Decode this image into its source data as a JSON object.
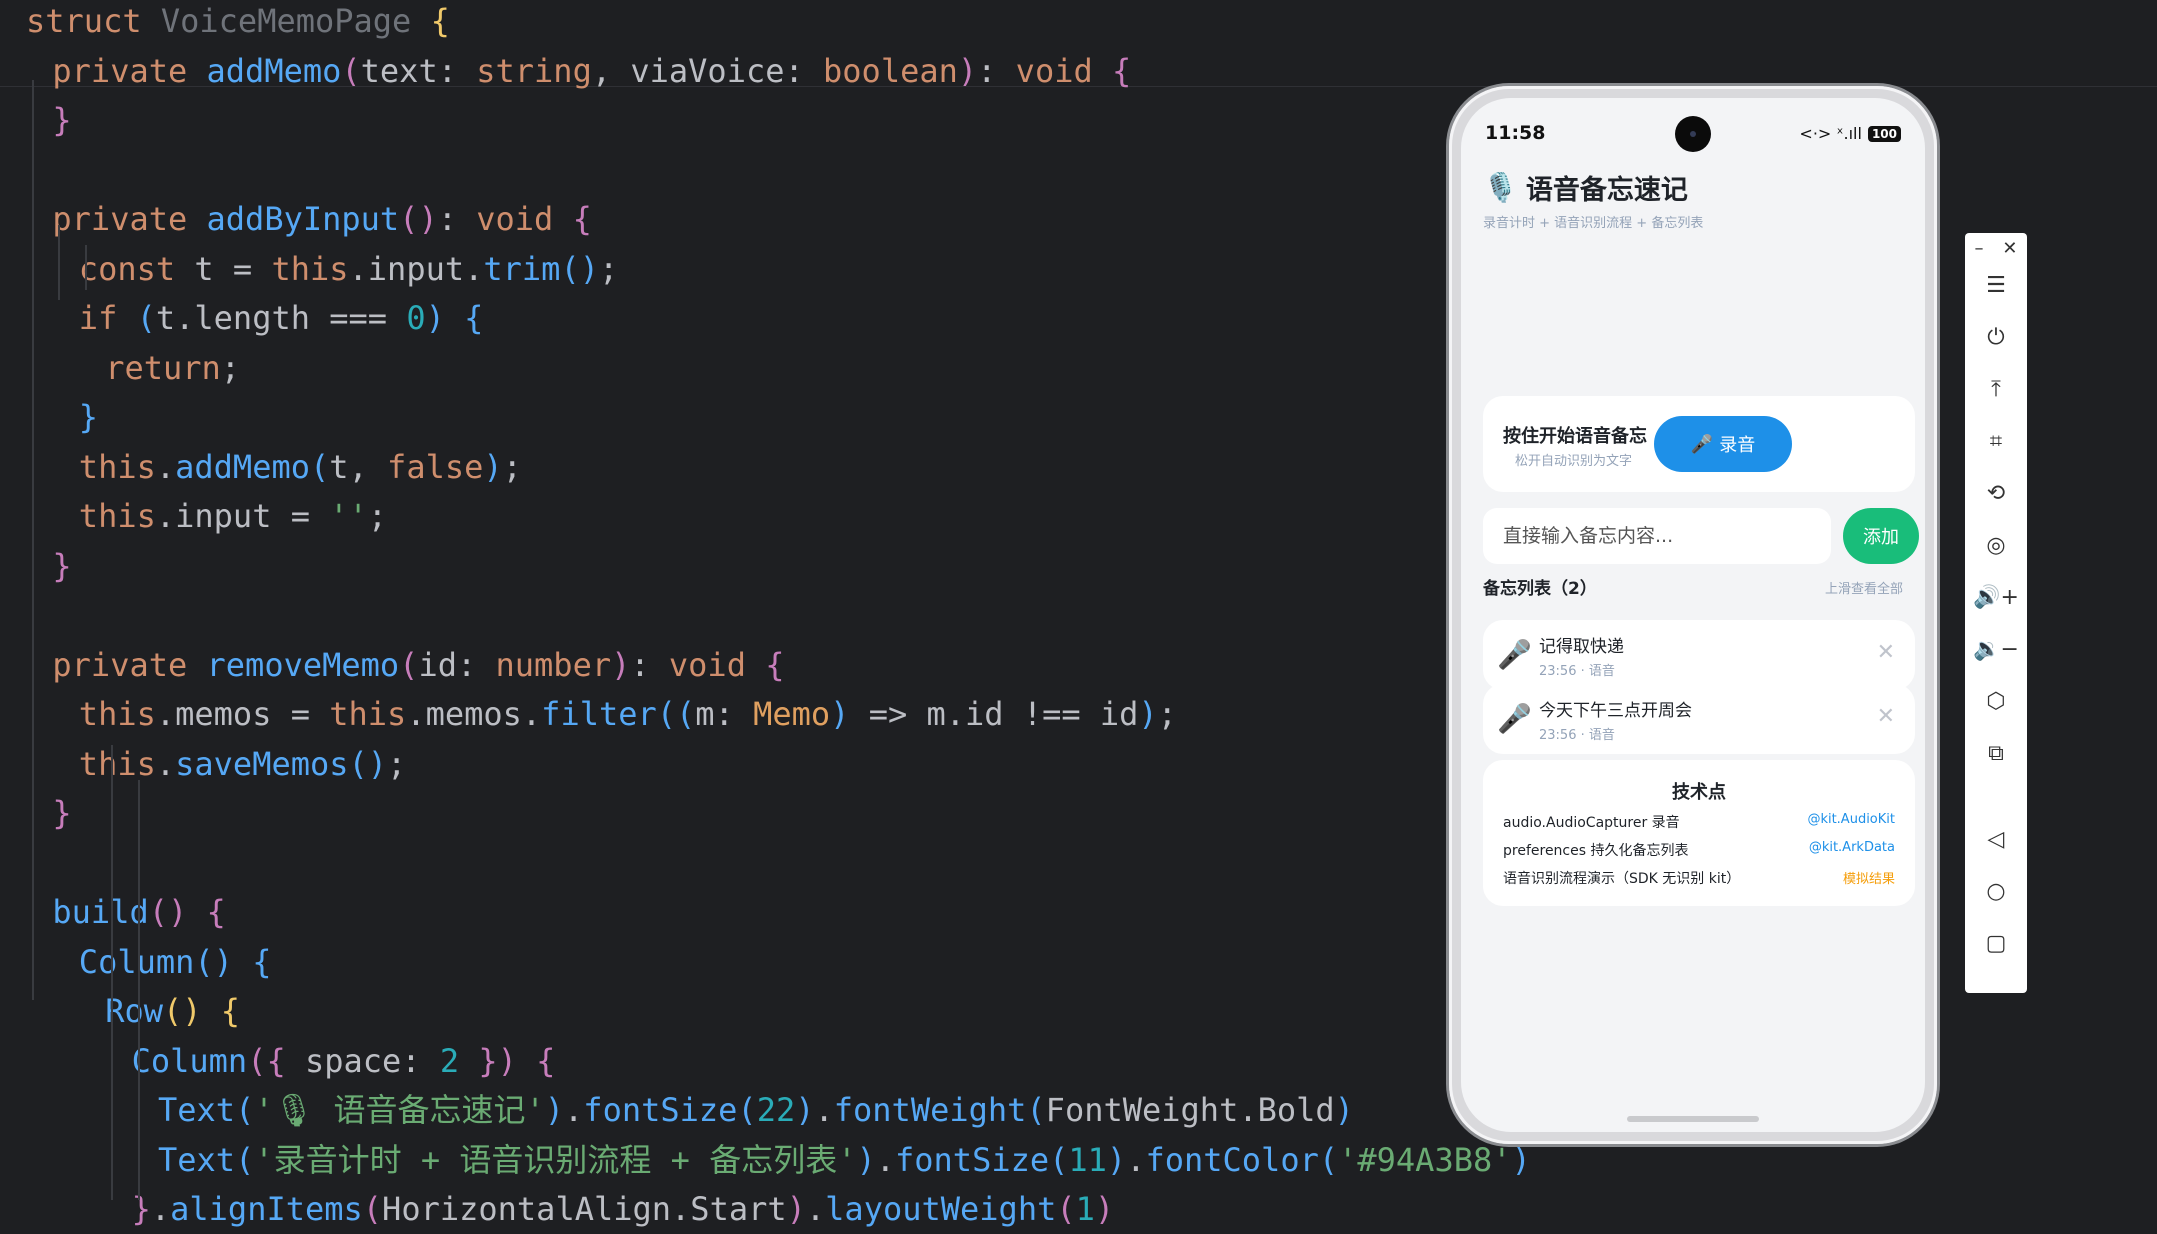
{
  "editor": {
    "lines": [
      {
        "indent": 0,
        "tokens": [
          [
            "kw",
            "struct "
          ],
          [
            "cls",
            "VoiceMemoPage "
          ],
          [
            "b1",
            "{"
          ]
        ]
      },
      {
        "indent": 1,
        "tokens": [
          [
            "kw",
            "private "
          ],
          [
            "fn",
            "addMemo"
          ],
          [
            "b2",
            "("
          ],
          [
            "pl",
            "text: "
          ],
          [
            "ty",
            "string"
          ],
          [
            "pl",
            ", viaVoice: "
          ],
          [
            "ty",
            "boolean"
          ],
          [
            "b2",
            ")"
          ],
          [
            "pl",
            ": "
          ],
          [
            "ty",
            "void "
          ],
          [
            "b2",
            "{"
          ]
        ]
      },
      {
        "indent": 1,
        "tokens": [
          [
            "b2",
            "}"
          ]
        ]
      },
      {
        "indent": 0,
        "tokens": []
      },
      {
        "indent": 1,
        "tokens": [
          [
            "kw",
            "private "
          ],
          [
            "fn",
            "addByInput"
          ],
          [
            "b2",
            "()"
          ],
          [
            "pl",
            ": "
          ],
          [
            "ty",
            "void "
          ],
          [
            "b2",
            "{"
          ]
        ]
      },
      {
        "indent": 2,
        "tokens": [
          [
            "kw",
            "const "
          ],
          [
            "pl",
            "t = "
          ],
          [
            "kw",
            "this"
          ],
          [
            "pl",
            ".input."
          ],
          [
            "fn",
            "trim"
          ],
          [
            "b3",
            "()"
          ],
          [
            "pl",
            ";"
          ]
        ]
      },
      {
        "indent": 2,
        "tokens": [
          [
            "kw",
            "if "
          ],
          [
            "b3",
            "("
          ],
          [
            "pl",
            "t.length === "
          ],
          [
            "nu",
            "0"
          ],
          [
            "b3",
            ") "
          ],
          [
            "b3",
            "{"
          ]
        ]
      },
      {
        "indent": 3,
        "tokens": [
          [
            "kw",
            "return"
          ],
          [
            "pl",
            ";"
          ]
        ]
      },
      {
        "indent": 2,
        "tokens": [
          [
            "b3",
            "}"
          ]
        ]
      },
      {
        "indent": 2,
        "tokens": [
          [
            "kw",
            "this"
          ],
          [
            "pl",
            "."
          ],
          [
            "fn",
            "addMemo"
          ],
          [
            "b3",
            "("
          ],
          [
            "pl",
            "t, "
          ],
          [
            "kw",
            "false"
          ],
          [
            "b3",
            ")"
          ],
          [
            "pl",
            ";"
          ]
        ]
      },
      {
        "indent": 2,
        "tokens": [
          [
            "kw",
            "this"
          ],
          [
            "pl",
            ".input = "
          ],
          [
            "st",
            "''"
          ],
          [
            "pl",
            ";"
          ]
        ]
      },
      {
        "indent": 1,
        "tokens": [
          [
            "b2",
            "}"
          ]
        ]
      },
      {
        "indent": 0,
        "tokens": []
      },
      {
        "indent": 1,
        "tokens": [
          [
            "kw",
            "private "
          ],
          [
            "fn",
            "removeMemo"
          ],
          [
            "b2",
            "("
          ],
          [
            "pl",
            "id: "
          ],
          [
            "ty",
            "number"
          ],
          [
            "b2",
            ")"
          ],
          [
            "pl",
            ": "
          ],
          [
            "ty",
            "void "
          ],
          [
            "b2",
            "{"
          ]
        ]
      },
      {
        "indent": 2,
        "tokens": [
          [
            "kw",
            "this"
          ],
          [
            "pl",
            ".memos = "
          ],
          [
            "kw",
            "this"
          ],
          [
            "pl",
            ".memos."
          ],
          [
            "fn",
            "filter"
          ],
          [
            "b3",
            "(("
          ],
          [
            "pl",
            "m: "
          ],
          [
            "tp",
            "Memo"
          ],
          [
            "b3",
            ") "
          ],
          [
            "pl",
            "=> m.id !== id"
          ],
          [
            "b3",
            ")"
          ],
          [
            "pl",
            ";"
          ]
        ]
      },
      {
        "indent": 2,
        "tokens": [
          [
            "kw",
            "this"
          ],
          [
            "pl",
            "."
          ],
          [
            "fn",
            "saveMemos"
          ],
          [
            "b3",
            "()"
          ],
          [
            "pl",
            ";"
          ]
        ]
      },
      {
        "indent": 1,
        "tokens": [
          [
            "b2",
            "}"
          ]
        ]
      },
      {
        "indent": 0,
        "tokens": []
      },
      {
        "indent": 1,
        "tokens": [
          [
            "fn",
            "build"
          ],
          [
            "b2",
            "() "
          ],
          [
            "b2",
            "{"
          ]
        ]
      },
      {
        "indent": 2,
        "tokens": [
          [
            "fn",
            "Column"
          ],
          [
            "b3",
            "() "
          ],
          [
            "b3",
            "{"
          ]
        ]
      },
      {
        "indent": 3,
        "tokens": [
          [
            "fn",
            "Row"
          ],
          [
            "b1",
            "() "
          ],
          [
            "b1",
            "{"
          ]
        ]
      },
      {
        "indent": 4,
        "tokens": [
          [
            "fn",
            "Column"
          ],
          [
            "b2",
            "({ "
          ],
          [
            "pl",
            "space: "
          ],
          [
            "nu",
            "2 "
          ],
          [
            "b2",
            "}) "
          ],
          [
            "b2",
            "{"
          ]
        ]
      },
      {
        "indent": 5,
        "tokens": [
          [
            "fn",
            "Text"
          ],
          [
            "b3",
            "("
          ],
          [
            "st",
            "'🎙 语音备忘速记'"
          ],
          [
            "b3",
            ")"
          ],
          [
            "pl",
            "."
          ],
          [
            "fn",
            "fontSize"
          ],
          [
            "b3",
            "("
          ],
          [
            "nu",
            "22"
          ],
          [
            "b3",
            ")"
          ],
          [
            "pl",
            "."
          ],
          [
            "fn",
            "fontWeight"
          ],
          [
            "b3",
            "("
          ],
          [
            "pl",
            "FontWeight.Bold"
          ],
          [
            "b3",
            ")"
          ]
        ]
      },
      {
        "indent": 5,
        "tokens": [
          [
            "fn",
            "Text"
          ],
          [
            "b3",
            "("
          ],
          [
            "st",
            "'录音计时 + 语音识别流程 + 备忘列表'"
          ],
          [
            "b3",
            ")"
          ],
          [
            "pl",
            "."
          ],
          [
            "fn",
            "fontSize"
          ],
          [
            "b3",
            "("
          ],
          [
            "nu",
            "11"
          ],
          [
            "b3",
            ")"
          ],
          [
            "pl",
            "."
          ],
          [
            "fn",
            "fontColor"
          ],
          [
            "b3",
            "("
          ],
          [
            "st",
            "'#94A3B8'"
          ],
          [
            "b3",
            ")"
          ]
        ]
      },
      {
        "indent": 4,
        "tokens": [
          [
            "b2",
            "}"
          ],
          [
            "pl",
            "."
          ],
          [
            "fn",
            "alignItems"
          ],
          [
            "b2",
            "("
          ],
          [
            "pl",
            "HorizontalAlign.Start"
          ],
          [
            "b2",
            ")"
          ],
          [
            "pl",
            "."
          ],
          [
            "fn",
            "layoutWeight"
          ],
          [
            "b2",
            "("
          ],
          [
            "nu",
            "1"
          ],
          [
            "b2",
            ")"
          ]
        ]
      }
    ]
  },
  "phone": {
    "status_time": "11:58",
    "status_net": "<·> ˣ.ıll",
    "battery": "100",
    "app_icon": "🎙️",
    "app_title": "语音备忘速记",
    "app_subtitle": "录音计时 + 语音识别流程 + 备忘列表",
    "record_title": "按住开始语音备忘",
    "record_hint": "松开自动识别为文字",
    "record_button": "录音",
    "record_button_icon": "🎤",
    "input_placeholder": "直接输入备忘内容...",
    "add_button": "添加",
    "list_header": "备忘列表（2）",
    "list_hint": "上滑查看全部",
    "memos": [
      {
        "icon": "🎤",
        "text": "记得取快递",
        "meta": "23:56 · 语音"
      },
      {
        "icon": "🎤",
        "text": "今天下午三点开周会",
        "meta": "23:56 · 语音"
      }
    ],
    "tech_title": "技术点",
    "tech_rows": [
      {
        "label": "audio.AudioCapturer 录音",
        "tag": "@kit.AudioKit",
        "tag_color": "#1e90e8"
      },
      {
        "label": "preferences 持久化备忘列表",
        "tag": "@kit.ArkData",
        "tag_color": "#1e90e8"
      },
      {
        "label": "语音识别流程演示（SDK 无识别 kit）",
        "tag": "模拟结果",
        "tag_color": "#f59e0b"
      }
    ]
  },
  "toolbar": {
    "minimize": "–",
    "close": "✕",
    "buttons": [
      {
        "name": "menu-icon",
        "glyph": "☰"
      },
      {
        "name": "power-icon",
        "glyph": "⏻"
      },
      {
        "name": "pin-top-icon",
        "glyph": "⤒"
      },
      {
        "name": "crop-icon",
        "glyph": "⌗"
      },
      {
        "name": "rotate-icon",
        "glyph": "⟲"
      },
      {
        "name": "location-icon",
        "glyph": "◎"
      },
      {
        "name": "volume-up-icon",
        "glyph": "🔊+"
      },
      {
        "name": "volume-down-icon",
        "glyph": "🔉−"
      },
      {
        "name": "eraser-icon",
        "glyph": "⬡"
      },
      {
        "name": "multi-device-icon",
        "glyph": "⧉"
      },
      {
        "name": "back-icon",
        "glyph": "◁"
      },
      {
        "name": "home-icon",
        "glyph": "○"
      },
      {
        "name": "recent-apps-icon",
        "glyph": "▢"
      }
    ]
  }
}
